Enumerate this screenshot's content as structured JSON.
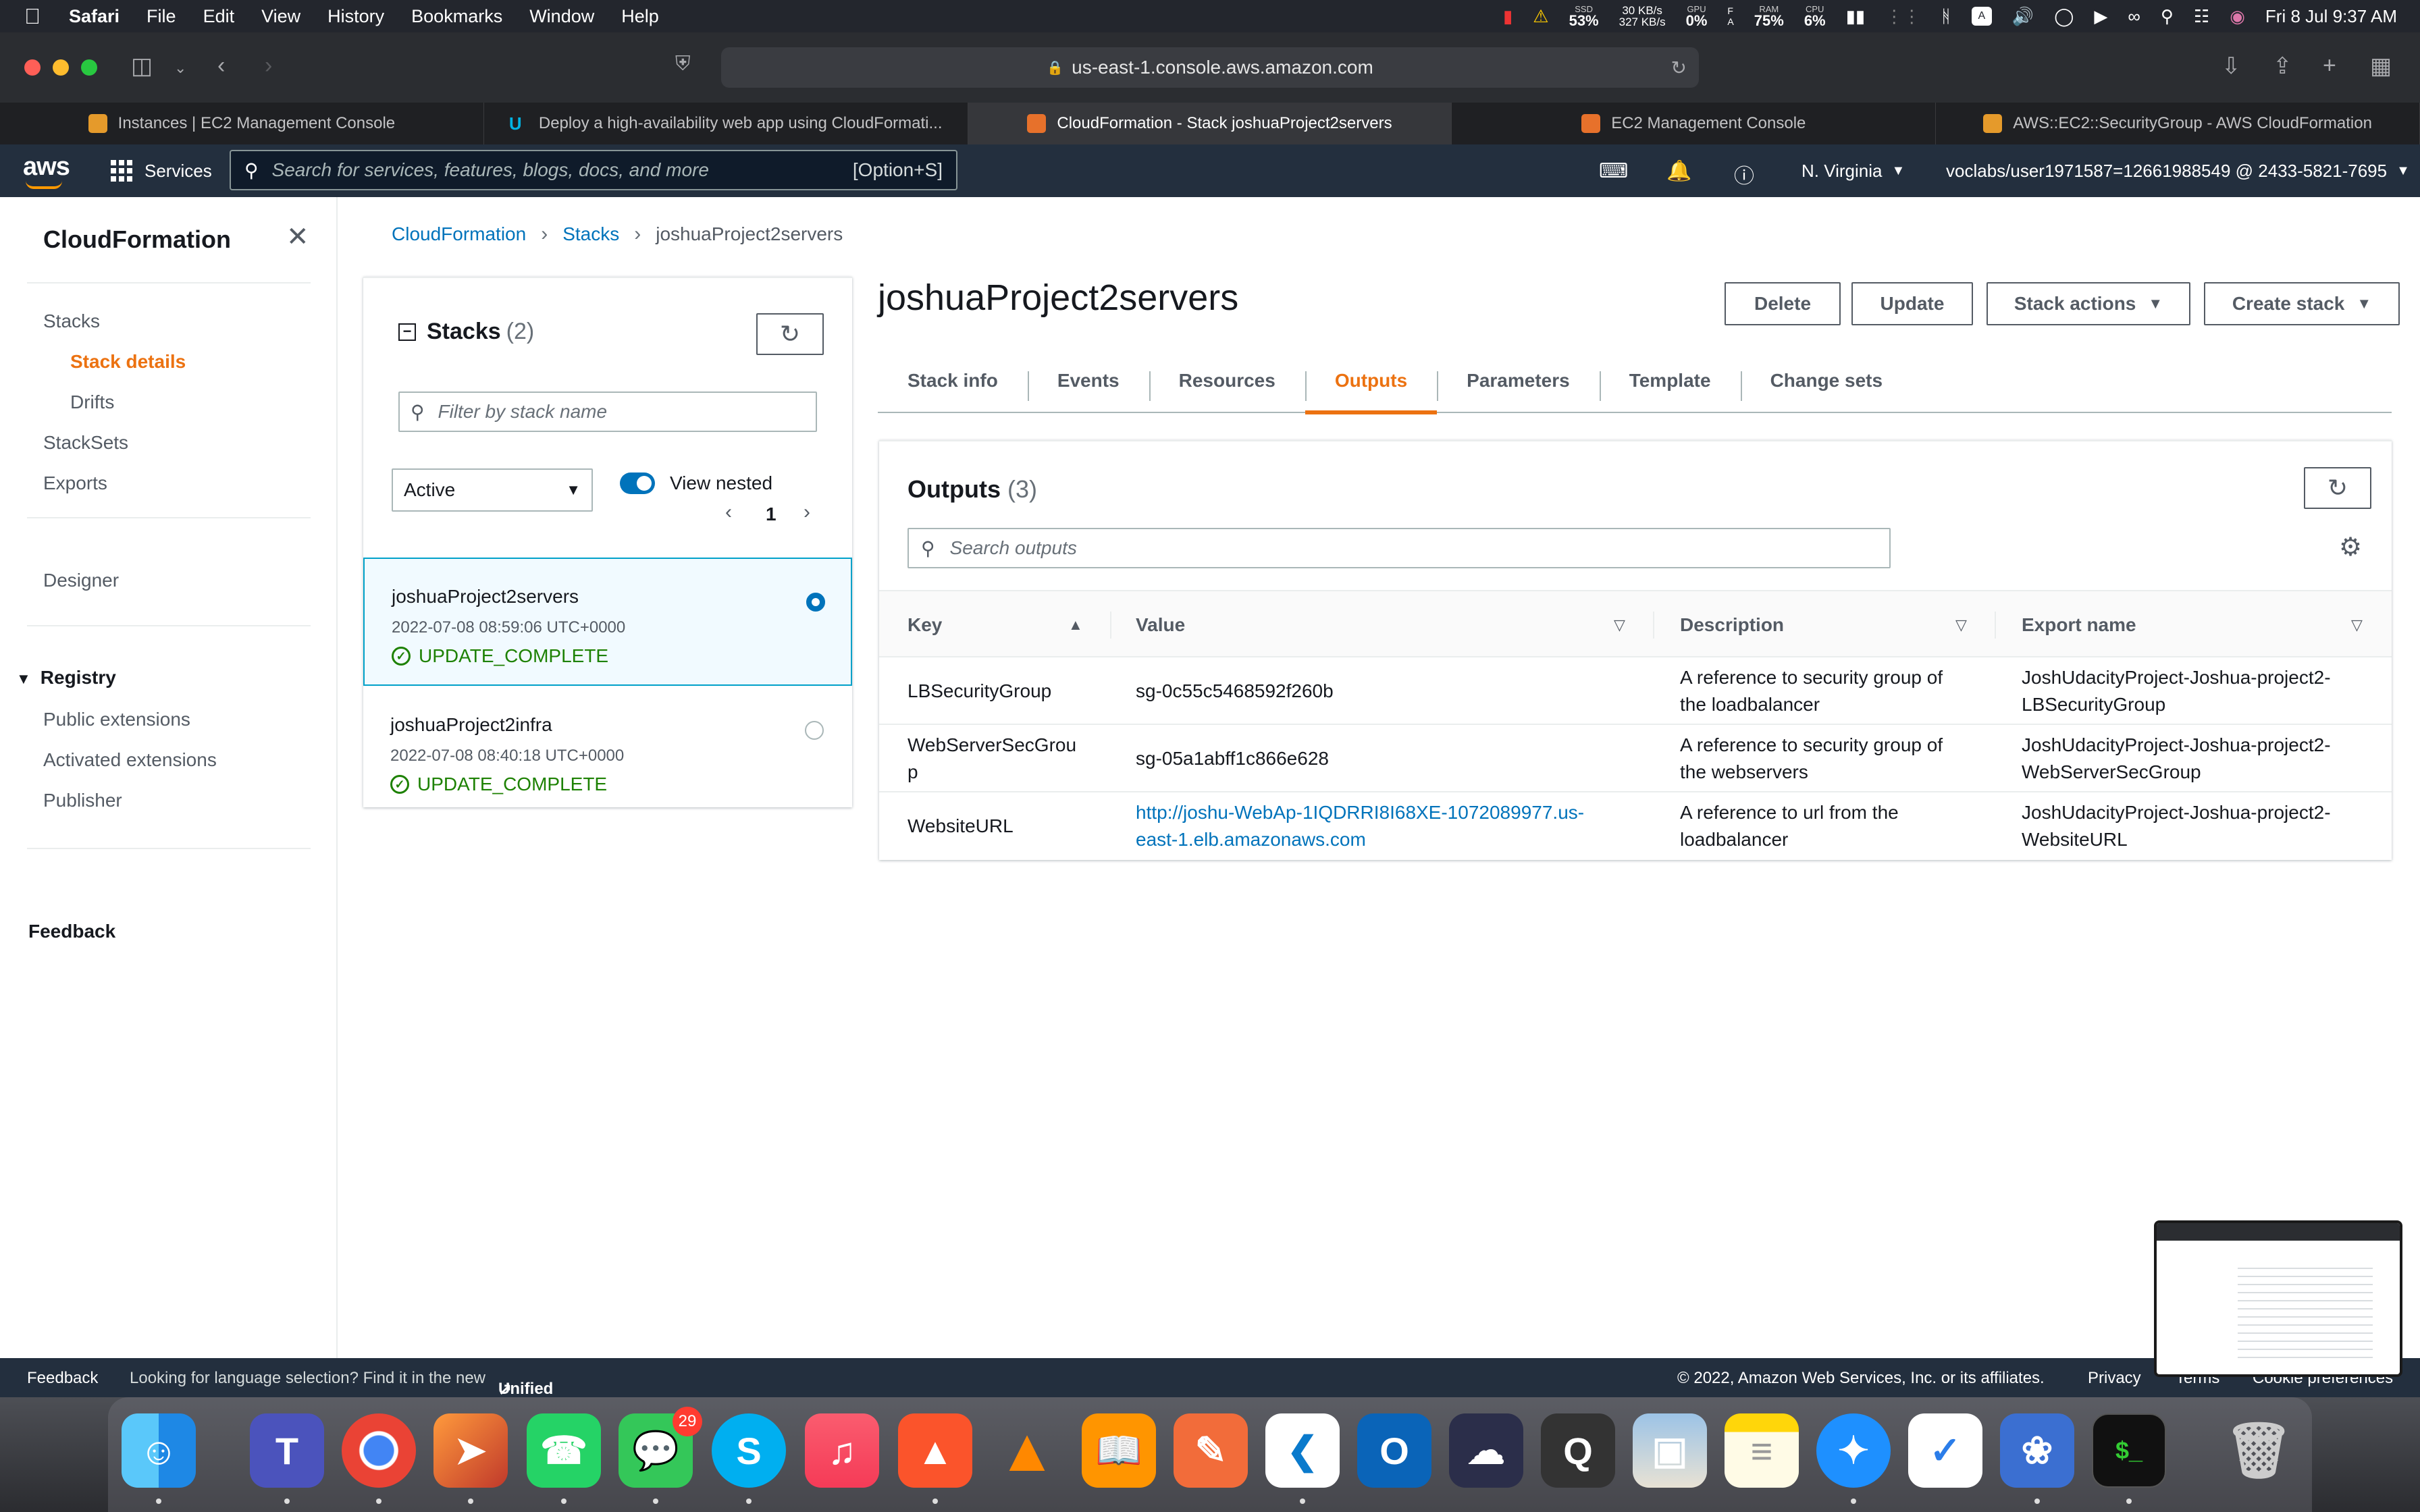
{
  "menubar": {
    "app": "Safari",
    "items": [
      "File",
      "Edit",
      "View",
      "History",
      "Bookmarks",
      "Window",
      "Help"
    ],
    "stats": {
      "ssd_label": "SSD",
      "ssd_value": "53%",
      "net_up": "30 KB/s",
      "net_down": "327 KB/s",
      "gpu_label": "GPU",
      "gpu_value": "0%",
      "ram_label": "RAM",
      "ram_value": "75%",
      "cpu_label": "CPU",
      "cpu_value": "6%"
    },
    "input_source": "A",
    "datetime": "Fri 8 Jul  9:37 AM"
  },
  "browser": {
    "url": "us-east-1.console.aws.amazon.com",
    "tabs": [
      {
        "title": "Instances | EC2 Management Console",
        "active": false
      },
      {
        "title": "Deploy a high-availability web app using CloudFormati...",
        "active": false
      },
      {
        "title": "CloudFormation - Stack joshuaProject2servers",
        "active": true
      },
      {
        "title": "EC2 Management Console",
        "active": false
      },
      {
        "title": "AWS::EC2::SecurityGroup - AWS CloudFormation",
        "active": false
      }
    ]
  },
  "aws_header": {
    "logo": "aws",
    "services_label": "Services",
    "search_placeholder": "Search for services, features, blogs, docs, and more",
    "search_shortcut": "[Option+S]",
    "region": "N. Virginia",
    "account": "voclabs/user1971587=12661988549 @ 2433-5821-7695"
  },
  "sidenav": {
    "title": "CloudFormation",
    "items": {
      "stacks": "Stacks",
      "stack_details": "Stack details",
      "drifts": "Drifts",
      "stacksets": "StackSets",
      "exports": "Exports",
      "designer": "Designer",
      "registry": "Registry",
      "public_extensions": "Public extensions",
      "activated_extensions": "Activated extensions",
      "publisher": "Publisher",
      "feedback": "Feedback"
    }
  },
  "breadcrumb": {
    "root": "CloudFormation",
    "level2": "Stacks",
    "current": "joshuaProject2servers"
  },
  "stacks_panel": {
    "title": "Stacks",
    "count": "(2)",
    "filter_placeholder": "Filter by stack name",
    "status_filter": "Active",
    "view_nested_label": "View nested",
    "page": "1",
    "stacks": [
      {
        "name": "joshuaProject2servers",
        "date": "2022-07-08 08:59:06 UTC+0000",
        "status": "UPDATE_COMPLETE",
        "selected": true
      },
      {
        "name": "joshuaProject2infra",
        "date": "2022-07-08 08:40:18 UTC+0000",
        "status": "UPDATE_COMPLETE",
        "selected": false
      }
    ]
  },
  "stack_detail": {
    "title": "joshuaProject2servers",
    "buttons": {
      "delete": "Delete",
      "update": "Update",
      "stack_actions": "Stack actions",
      "create_stack": "Create stack"
    },
    "tabs": [
      "Stack info",
      "Events",
      "Resources",
      "Outputs",
      "Parameters",
      "Template",
      "Change sets"
    ],
    "active_tab": "Outputs"
  },
  "outputs": {
    "title": "Outputs",
    "count": "(3)",
    "search_placeholder": "Search outputs",
    "columns": {
      "key": "Key",
      "value": "Value",
      "description": "Description",
      "export_name": "Export name"
    },
    "rows": [
      {
        "key": "LBSecurityGroup",
        "value": "sg-0c55c5468592f260b",
        "description_l1": "A reference to security group of",
        "description_l2": "the loadbalancer",
        "export_l1": "JoshUdacityProject-Joshua-project2-",
        "export_l2": "LBSecurityGroup"
      },
      {
        "key_l1": "WebServerSecGrou",
        "key_l2": "p",
        "value": "sg-05a1abff1c866e628",
        "description_l1": "A reference to security group of",
        "description_l2": "the webservers",
        "export_l1": "JoshUdacityProject-Joshua-project2-",
        "export_l2": "WebServerSecGroup"
      },
      {
        "key": "WebsiteURL",
        "value_l1": "http://joshu-WebAp-1IQDRRI8I68XE-1072089977.us-",
        "value_l2": "east-1.elb.amazonaws.com",
        "description_l1": "A reference to url from the",
        "description_l2": "loadbalancer",
        "export_l1": "JoshUdacityProject-Joshua-project2-",
        "export_l2": "WebsiteURL"
      }
    ]
  },
  "footer": {
    "feedback": "Feedback",
    "language_prompt": "Looking for language selection? Find it in the new",
    "unified_settings": "Unified Settings",
    "copyright": "© 2022, Amazon Web Services, Inc. or its affiliates.",
    "privacy": "Privacy",
    "terms": "Terms",
    "cookie": "Cookie preferences"
  },
  "dock": {
    "messages_badge": "29"
  },
  "colors": {
    "aws_header": "#232f3e",
    "aws_orange": "#ec7211",
    "link_blue": "#0073bb",
    "success_green": "#1d8102"
  }
}
